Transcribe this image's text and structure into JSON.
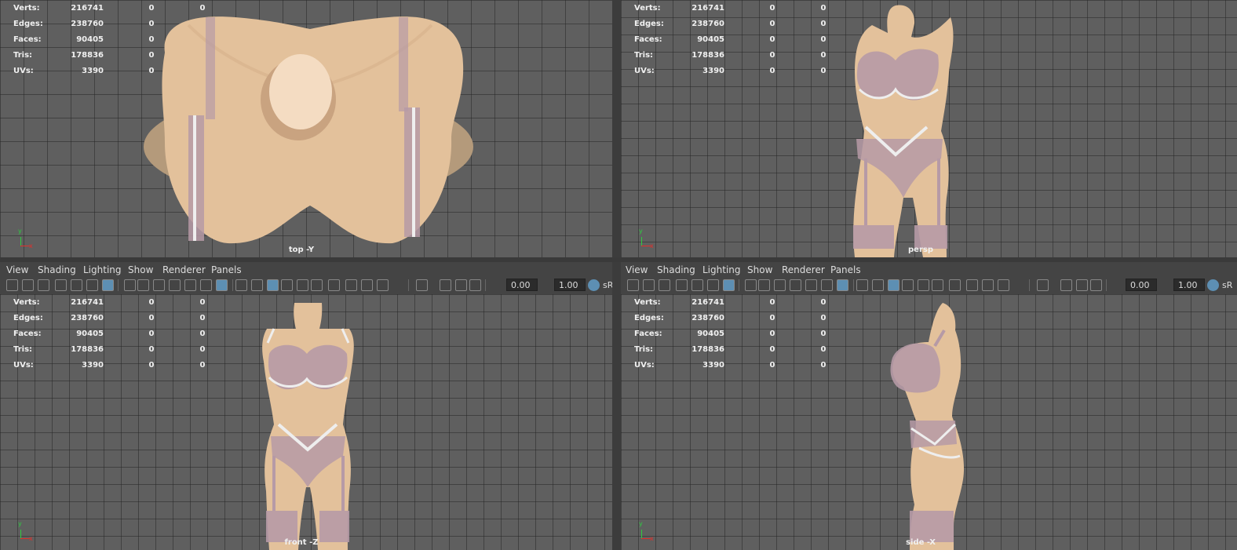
{
  "stats": {
    "labels": [
      "Verts:",
      "Edges:",
      "Faces:",
      "Tris:",
      "UVs:"
    ],
    "values": [
      "216741",
      "238760",
      "90405",
      "178836",
      "3390"
    ],
    "zero": "0"
  },
  "viewports": {
    "top": {
      "camera": "top -Y"
    },
    "persp": {
      "camera": "persp"
    },
    "front": {
      "camera": "front -Z"
    },
    "side": {
      "camera": "side -X"
    }
  },
  "gizmo": {
    "y": "y",
    "x": "x"
  },
  "panel_menu": {
    "view": "View",
    "shading": "Shading",
    "lighting": "Lighting",
    "show": "Show",
    "renderer": "Renderer",
    "panels": "Panels"
  },
  "toolbar": {
    "exposure": "0.00",
    "gamma": "1.00",
    "colorspace": "sR"
  },
  "colors": {
    "viewport_bg": "#5f5f5f",
    "skin": "#e3c19b",
    "lace": "#b69aa6",
    "trim": "#eeeeee",
    "active_icon": "#5d8fb3"
  }
}
